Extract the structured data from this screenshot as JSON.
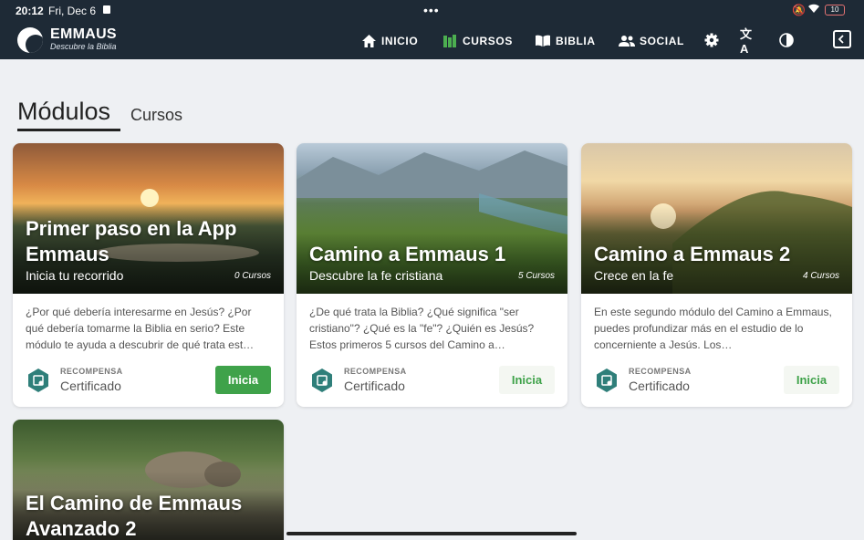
{
  "status_bar": {
    "time": "20:12",
    "date": "Fri, Dec 6",
    "dots": "•••",
    "battery": "10"
  },
  "app": {
    "brand": "EMMAUS",
    "brand_sub": "Descubre la Biblia"
  },
  "nav": {
    "inicio": "INICIO",
    "cursos": "CURSOS",
    "biblia": "BIBLIA",
    "social": "SOCIAL",
    "translate_glyph": "文A"
  },
  "page": {
    "heading": "Módulos",
    "subheading": "Cursos"
  },
  "colors": {
    "appbar": "#1e2a36",
    "accent_green": "#3fa24a",
    "badge_teal": "#2f7f7a"
  },
  "modules": [
    {
      "title": "Primer paso en la App Emmaus",
      "subtitle": "Inicia tu recorrido",
      "count": "0 Cursos",
      "description": "¿Por qué debería interesarme en Jesús? ¿Por qué debería tomarme la Biblia en serio? Este módulo te ayuda a descubrir de qué trata est…",
      "reward_label": "RECOMPENSA",
      "reward_value": "Certificado",
      "button": "Inicia"
    },
    {
      "title": "Camino a Emmaus 1",
      "subtitle": "Descubre la fe cristiana",
      "count": "5 Cursos",
      "description": "¿De qué trata la Biblia? ¿Qué significa \"ser cristiano\"? ¿Qué es la \"fe\"? ¿Quién es Jesús? Estos primeros 5 cursos del Camino a…",
      "reward_label": "RECOMPENSA",
      "reward_value": "Certificado",
      "button": "Inicia"
    },
    {
      "title": "Camino a Emmaus 2",
      "subtitle": "Crece en la fe",
      "count": "4 Cursos",
      "description": "En este segundo módulo del Camino a Emmaus, puedes profundizar más en el estudio de lo concerniente a Jesús. Los…",
      "reward_label": "RECOMPENSA",
      "reward_value": "Certificado",
      "button": "Inicia"
    },
    {
      "title": "El Camino de Emmaus Avanzado 2"
    }
  ]
}
